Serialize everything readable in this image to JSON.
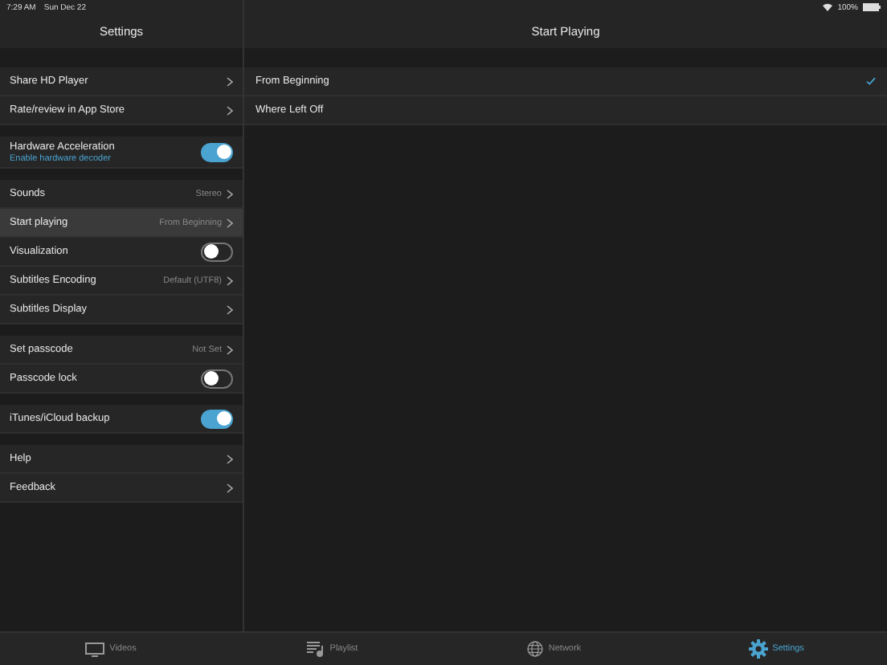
{
  "status_bar": {
    "time": "7:29 AM",
    "date": "Sun Dec 22",
    "battery_text": "100%"
  },
  "settings": {
    "title": "Settings",
    "sections": [
      {
        "rows": [
          {
            "kind": "link",
            "label": "Share HD Player",
            "selected": false
          },
          {
            "kind": "link",
            "label": "Rate/review in App Store",
            "selected": false
          }
        ]
      },
      {
        "rows": [
          {
            "kind": "toggle",
            "label": "Hardware Acceleration",
            "subtitle": "Enable hardware decoder",
            "on": true,
            "selected": false
          }
        ]
      },
      {
        "rows": [
          {
            "kind": "link",
            "label": "Sounds",
            "value": "Stereo",
            "selected": false
          },
          {
            "kind": "link",
            "label": "Start playing",
            "value": "From Beginning",
            "selected": true
          },
          {
            "kind": "toggle",
            "label": "Visualization",
            "on": false,
            "selected": false
          },
          {
            "kind": "link",
            "label": "Subtitles Encoding",
            "value": "Default (UTF8)",
            "selected": false
          },
          {
            "kind": "link",
            "label": "Subtitles Display",
            "selected": false
          }
        ]
      },
      {
        "rows": [
          {
            "kind": "link",
            "label": "Set passcode",
            "value": "Not Set",
            "selected": false
          },
          {
            "kind": "toggle",
            "label": "Passcode lock",
            "on": false,
            "selected": false
          }
        ]
      },
      {
        "rows": [
          {
            "kind": "toggle",
            "label": "iTunes/iCloud backup",
            "on": true,
            "selected": false
          }
        ]
      },
      {
        "rows": [
          {
            "kind": "link",
            "label": "Help",
            "selected": false
          },
          {
            "kind": "link",
            "label": "Feedback",
            "selected": false
          }
        ]
      }
    ]
  },
  "detail": {
    "title": "Start Playing",
    "options": [
      {
        "label": "From Beginning",
        "selected": true
      },
      {
        "label": "Where Left Off",
        "selected": false
      }
    ]
  },
  "tab_bar": [
    {
      "kind": "videos",
      "label": "Videos",
      "selected": false
    },
    {
      "kind": "playlist",
      "label": "Playlist",
      "selected": false
    },
    {
      "kind": "network",
      "label": "Network",
      "selected": false
    },
    {
      "kind": "settings",
      "label": "Settings",
      "selected": true
    }
  ]
}
